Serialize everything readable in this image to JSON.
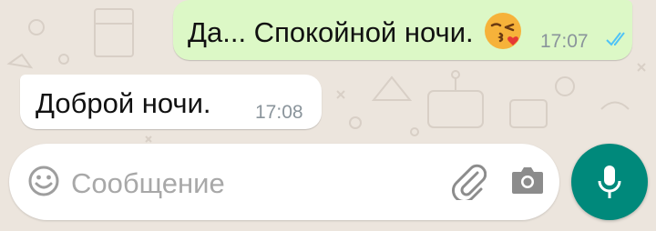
{
  "messages": [
    {
      "direction": "outgoing",
      "text": "Да... Спокойной ночи.",
      "emoji": "kissing-face-icon",
      "time": "17:07",
      "status": "read"
    },
    {
      "direction": "incoming",
      "text": "Доброй ночи.",
      "time": "17:08"
    }
  ],
  "composer": {
    "placeholder": "Сообщение",
    "left_icon": "emoji-icon",
    "attach_icon": "paperclip-icon",
    "camera_icon": "camera-icon",
    "send_icon": "microphone-icon"
  },
  "colors": {
    "background": "#ECE5DD",
    "outgoing_bubble": "#DCF8C6",
    "incoming_bubble": "#FFFFFF",
    "read_ticks": "#4FC3F7",
    "mic_button": "#00897B"
  }
}
